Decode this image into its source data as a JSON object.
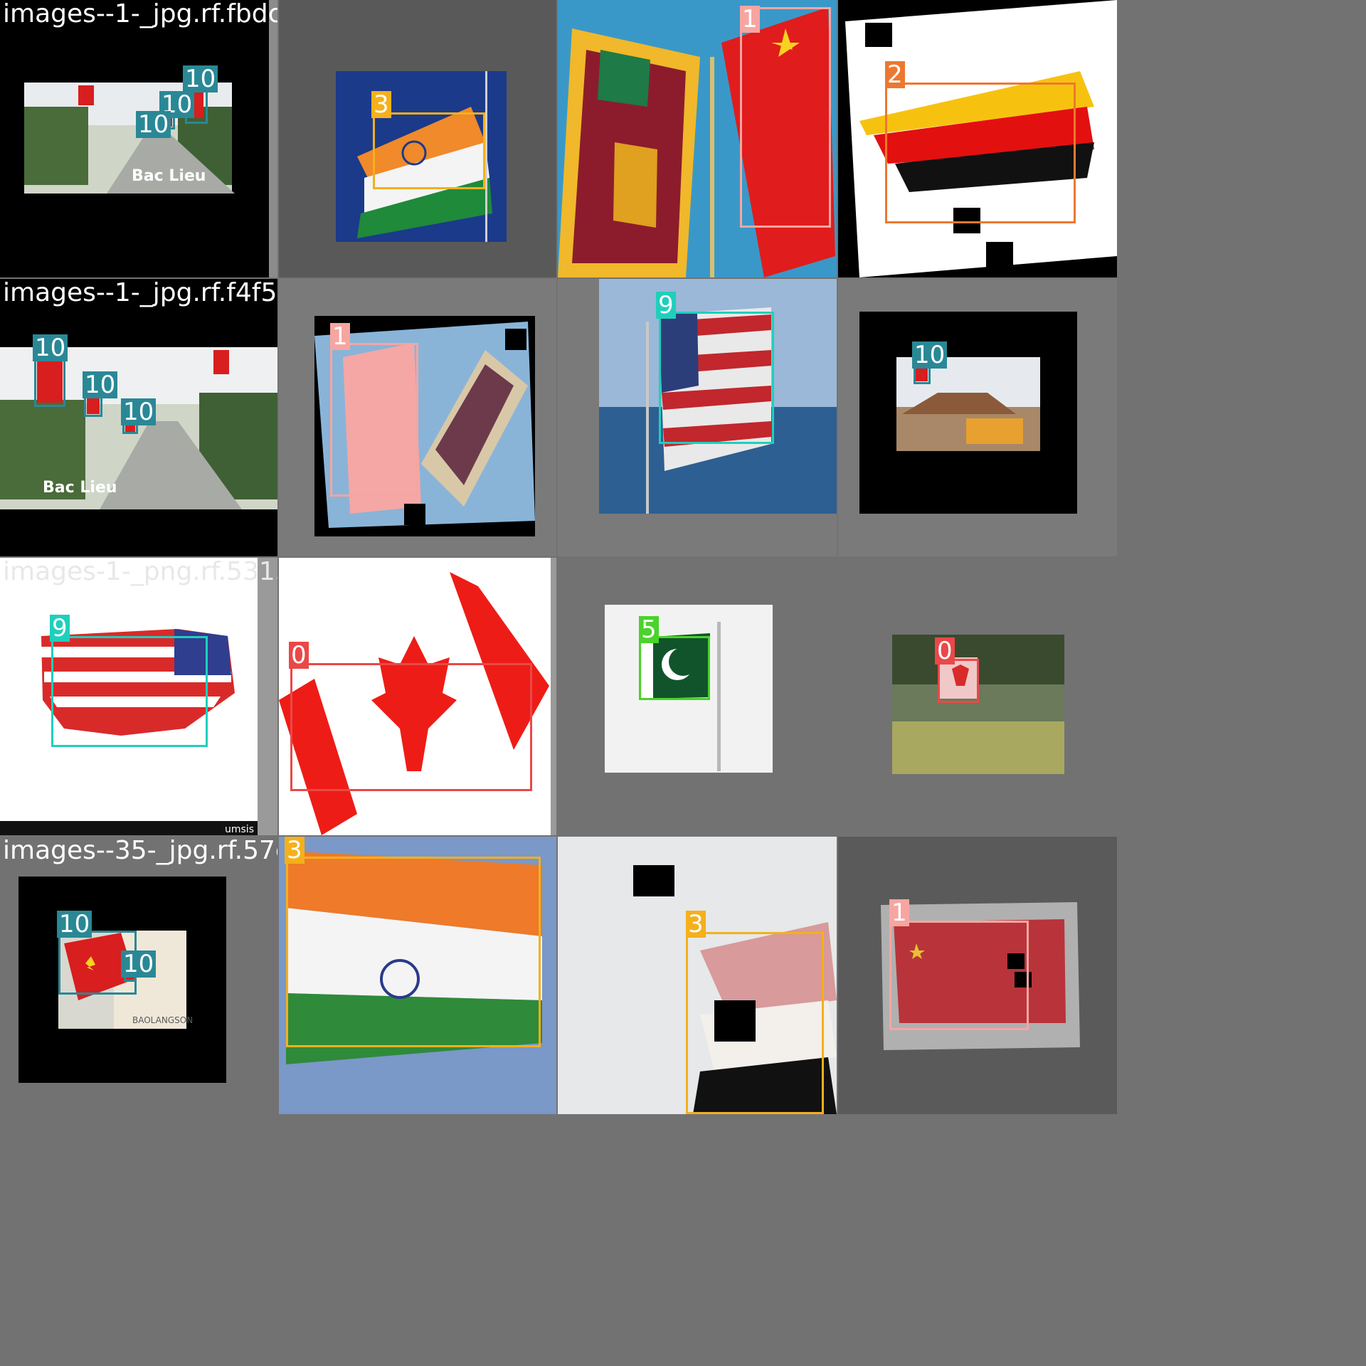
{
  "tiles": [
    {
      "filename": "images--1-_jpg.rf.fbdc8f45a2",
      "overlay": "images-2400_jpg.rf.fa039c9f32",
      "labels": [
        "10",
        "10",
        "10"
      ],
      "scene_text": "Bac Lieu"
    },
    {
      "filename": "images-4-_jpg.rf.fa039c9f32",
      "labels": [
        "3"
      ]
    },
    {
      "filename": "images-2-1976_jpg.rf.1826d4c8",
      "labels": [
        "1"
      ]
    },
    {
      "filename": "images-91e1_png.rf.4c4c3e69c",
      "labels": [
        "2"
      ]
    },
    {
      "filename": "images--1-_jpg.rf.f4f59d207f",
      "overlay": "images-2-1526_jpg.rf.155b7690",
      "labels": [
        "10",
        "10",
        "10"
      ],
      "scene_text": "Bac Lieu"
    },
    {
      "filename": "images-2-1526_jpg.rf.155b7690",
      "labels": [
        "1"
      ]
    },
    {
      "filename": "images-5-1096_jpg.rf.546f612d9",
      "labels": [
        "9"
      ]
    },
    {
      "filename": "images-2-41-8_jpg.rf.6932e12c",
      "labels": [
        "10"
      ]
    },
    {
      "filename": "images-1-_png.rf.531580cdbd",
      "overlay": "images-1-_png.rf.6028648262",
      "labels": [
        "9"
      ],
      "scene_text": "umsis"
    },
    {
      "filename": "images-1-_png.rf.6028648262",
      "labels": [
        "0"
      ]
    },
    {
      "filename": "images-2a-_jpg.rf.d4b8ebea6528",
      "labels": [
        "5"
      ]
    },
    {
      "filename": "images-3-_jpg.rf.553c92e6b6",
      "labels": [
        "0"
      ]
    },
    {
      "filename": "images--35-_jpg.rf.57cef032",
      "overlay": "images-1-_jpg.rf.1a224bf15e",
      "labels": [
        "10",
        "10"
      ],
      "scene_text": "BAOLANGSON"
    },
    {
      "filename": "images-64_jpg.rf.1a224bf15e",
      "labels": [
        "3"
      ]
    },
    {
      "filename": "images-5_jpg.rf.ae0fff8bc5",
      "labels": [
        "3"
      ]
    },
    {
      "filename": "202762991-9_jpg.rf.d3c149894c",
      "labels": [
        "1"
      ]
    }
  ],
  "colors": {
    "class_0": "#ea4848",
    "class_1": "#f7a5a0",
    "class_2": "#ec7830",
    "class_3": "#f5b01b",
    "class_5": "#4ad32a",
    "class_9": "#1fcfbc",
    "class_10": "#2a8896"
  }
}
